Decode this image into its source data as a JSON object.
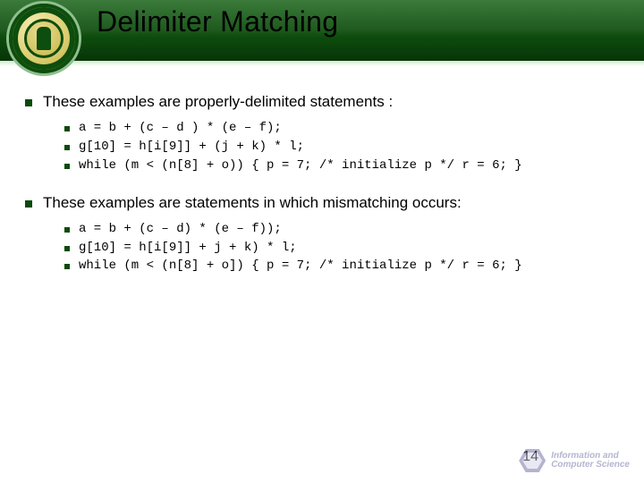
{
  "header": {
    "title": "Delimiter Matching"
  },
  "sections": [
    {
      "heading": "These examples are properly-delimited statements :",
      "items": [
        "a = b + (c – d ) * (e – f);",
        "g[10] = h[i[9]] + (j + k) * l;",
        "while (m < (n[8] + o)) { p = 7; /* initialize p */ r = 6; }"
      ]
    },
    {
      "heading": "These examples are statements in which mismatching occurs:",
      "items": [
        "a = b + (c – d) * (e – f));",
        "g[10] = h[i[9]] + j + k) * l;",
        "while (m < (n[8] + o]) { p = 7; /* initialize p */ r = 6; }"
      ]
    }
  ],
  "footer": {
    "dept_line1": "Information and",
    "dept_line2": "Computer Science",
    "page": "14"
  }
}
